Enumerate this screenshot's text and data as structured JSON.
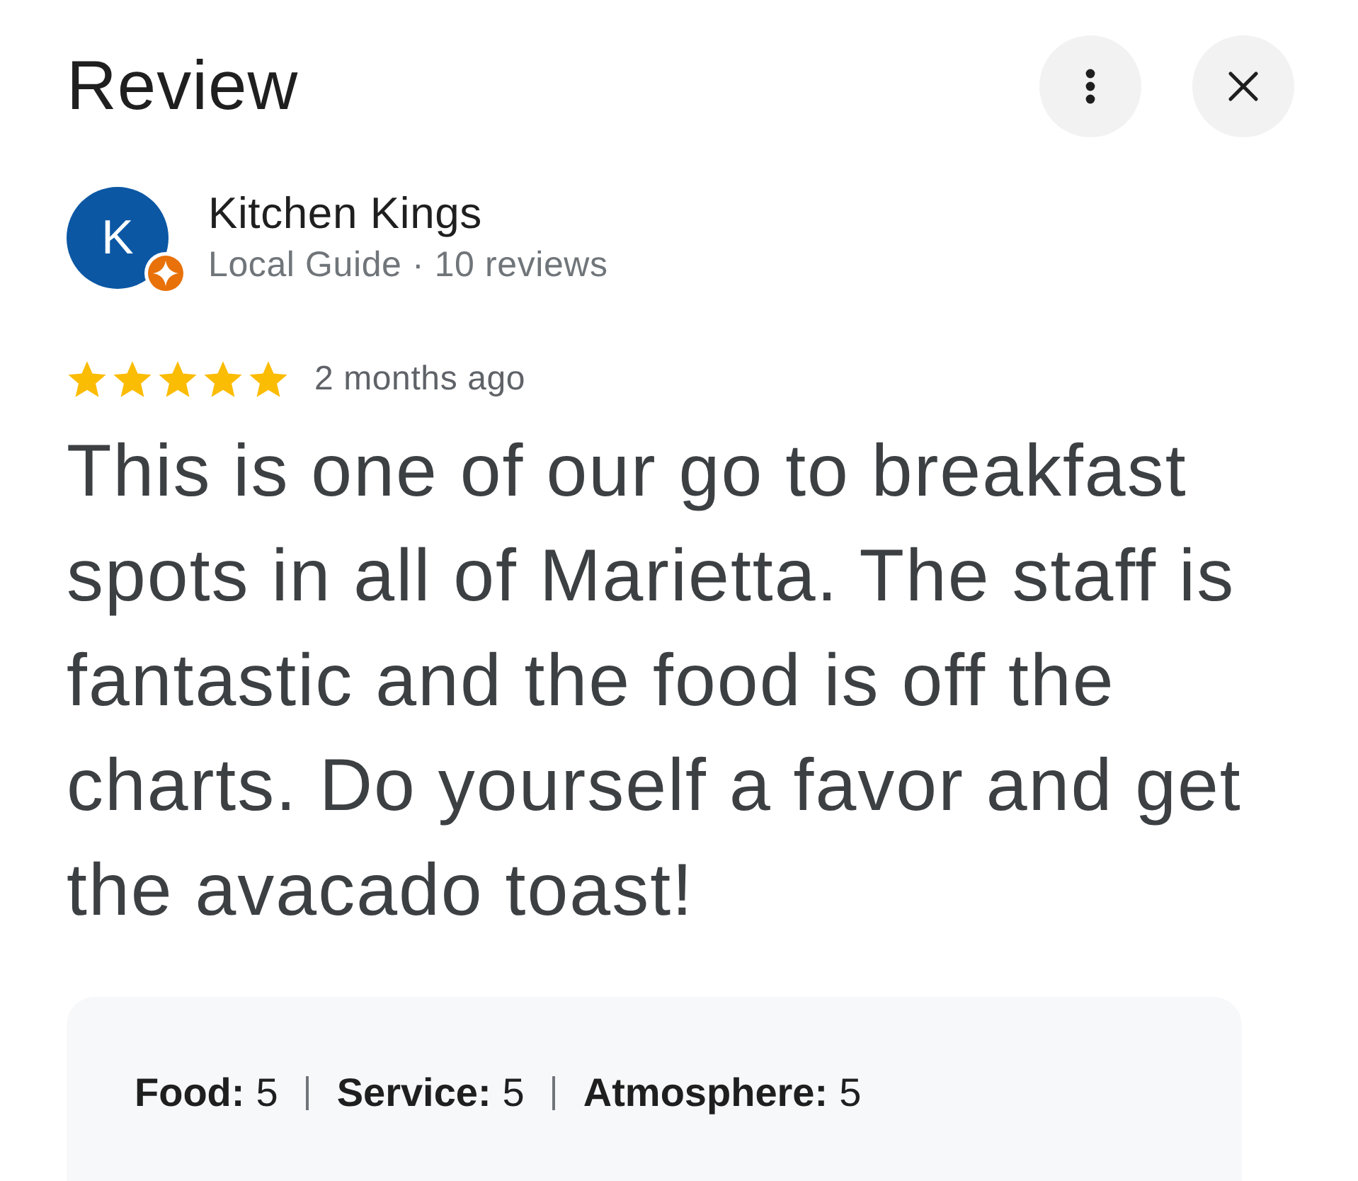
{
  "header": {
    "title": "Review",
    "buttons": [
      {
        "kind": "more"
      },
      {
        "kind": "close"
      }
    ]
  },
  "reviewer": {
    "initial": "K",
    "name": "Kitchen Kings",
    "subtitle": "Local Guide · 10 reviews",
    "local_guide_badge": true
  },
  "review": {
    "stars": 5,
    "time": "2 months ago",
    "text": "This is one of our go to breakfast spots in all of Marietta. The staff is fantastic and the food is off the charts. Do yourself a favor and get the avacado toast!"
  },
  "ratings": [
    {
      "label": "Food:",
      "value": "5"
    },
    {
      "label": "Service:",
      "value": "5"
    },
    {
      "label": "Atmosphere:",
      "value": "5"
    }
  ]
}
